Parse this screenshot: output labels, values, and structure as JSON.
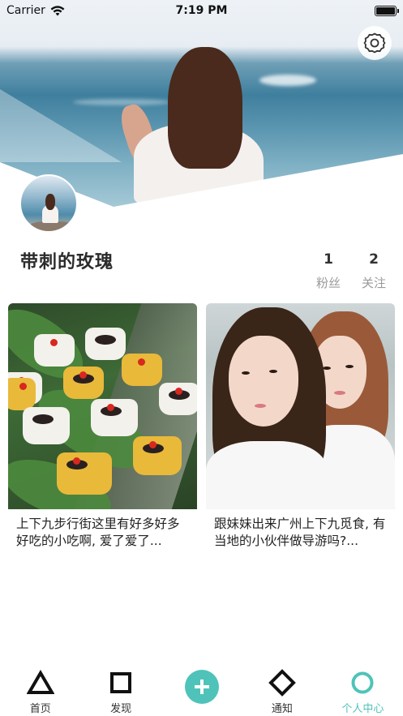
{
  "status_bar": {
    "carrier": "Carrier",
    "time": "7:19 PM"
  },
  "profile": {
    "username": "带刺的玫瑰",
    "stats": [
      {
        "count": "1",
        "label": "粉丝"
      },
      {
        "count": "2",
        "label": "关注"
      }
    ]
  },
  "posts": [
    {
      "title": "上下九步行街这里有好多好多好吃的小吃啊, 爱了爱了..."
    },
    {
      "title": "跟妹妹出来广州上下九觅食, 有当地的小伙伴做导游吗?..."
    }
  ],
  "tabbar": {
    "items": [
      {
        "label": "首页",
        "icon": "triangle-icon"
      },
      {
        "label": "发现",
        "icon": "square-icon"
      },
      {
        "label": "",
        "icon": "plus-icon"
      },
      {
        "label": "通知",
        "icon": "diamond-icon"
      },
      {
        "label": "个人中心",
        "icon": "circle-icon"
      }
    ],
    "active_color": "#4fc3b9"
  }
}
